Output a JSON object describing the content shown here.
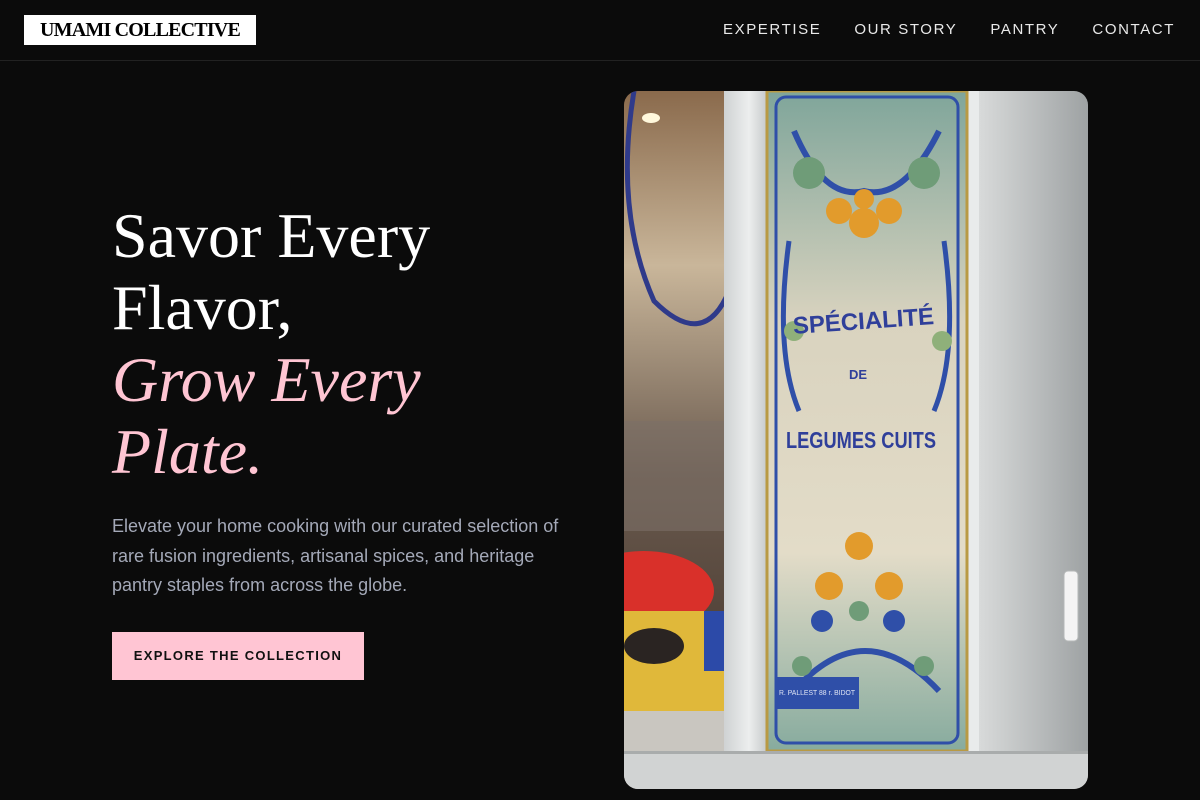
{
  "brand": {
    "name": "UMAMI COLLECTIVE"
  },
  "nav": {
    "items": [
      {
        "label": "EXPERTISE"
      },
      {
        "label": "OUR STORY"
      },
      {
        "label": "PANTRY"
      },
      {
        "label": "CONTACT"
      }
    ]
  },
  "hero": {
    "title_line1": "Savor Every",
    "title_line2": "Flavor,",
    "title_accent_line1": "Grow Every",
    "title_accent_line2": "Plate.",
    "description": "Elevate your home cooking with our curated selection of rare fusion ingredients, artisanal spices, and heritage pantry staples from across the globe.",
    "cta_label": "EXPLORE THE COLLECTION"
  },
  "image": {
    "sign_line1": "SPÉCIALITÉ",
    "sign_line2": "DE",
    "sign_line3": "LEGUMES CUITS",
    "plaque": "R. PALLEST 88 r. BIDOT"
  },
  "colors": {
    "background": "#0b0b0b",
    "accent": "#ffc5d3",
    "body_text": "#a4a9b8",
    "headline": "#ffffff"
  }
}
